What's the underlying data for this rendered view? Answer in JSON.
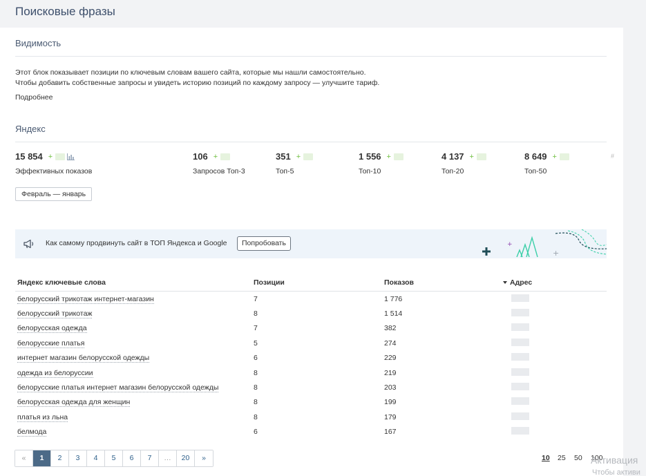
{
  "page": {
    "title": "Поисковые фразы"
  },
  "visibility": {
    "title": "Видимость",
    "desc_line1": "Этот блок показывает позиции по ключевым словам вашего сайта, которые мы нашли самостоятельно.",
    "desc_line2": "Чтобы добавить собственные запросы и увидеть историю позиций по каждому запросу — улучшите тариф.",
    "more_link": "Подробнее"
  },
  "yandex": {
    "title": "Яндекс",
    "stats": [
      {
        "value": "15 854",
        "plus": "+",
        "label": "Эффективных показов"
      },
      {
        "value": "106",
        "plus": "+",
        "label": "Запросов Топ-3"
      },
      {
        "value": "351",
        "plus": "+",
        "label": "Топ-5"
      },
      {
        "value": "1 556",
        "plus": "+",
        "label": "Топ-10"
      },
      {
        "value": "4 137",
        "plus": "+",
        "label": "Топ-20"
      },
      {
        "value": "8 649",
        "plus": "+",
        "label": "Топ-50"
      }
    ],
    "hash": "#",
    "period_button": "Февраль — январь"
  },
  "promo": {
    "text": "Как самому продвинуть сайт в ТОП Яндекса и Google",
    "button": "Попробовать",
    "colors": {
      "bg": "#eef4fa",
      "accent_green": "#3ccfa8",
      "accent_dark": "#1f4d57",
      "accent_purple": "#8e44ad"
    }
  },
  "table": {
    "headers": {
      "keyword": "Яндекс ключевые слова",
      "position": "Позиции",
      "views": "Показов",
      "address": "Адрес"
    },
    "rows": [
      {
        "keyword": "белорусский трикотаж интернет-магазин",
        "position": "7",
        "views": "1 776"
      },
      {
        "keyword": "белорусский трикотаж",
        "position": "8",
        "views": "1 514"
      },
      {
        "keyword": "белорусская одежда",
        "position": "7",
        "views": "382"
      },
      {
        "keyword": "белорусские платья",
        "position": "5",
        "views": "274"
      },
      {
        "keyword": "интернет магазин белорусской одежды",
        "position": "6",
        "views": "229"
      },
      {
        "keyword": "одежда из белоруссии",
        "position": "8",
        "views": "219"
      },
      {
        "keyword": "белорусские платья интернет магазин белорусской одежды",
        "position": "8",
        "views": "203"
      },
      {
        "keyword": "белорусская одежда для женщин",
        "position": "8",
        "views": "199"
      },
      {
        "keyword": "платья из льна",
        "position": "8",
        "views": "179"
      },
      {
        "keyword": "белмода",
        "position": "6",
        "views": "167"
      }
    ]
  },
  "pagination": {
    "prev": "«",
    "pages": [
      "1",
      "2",
      "3",
      "4",
      "5",
      "6",
      "7"
    ],
    "ellipsis": "…",
    "last": "20",
    "next": "»",
    "active": "1",
    "page_sizes": [
      "10",
      "25",
      "50",
      "100"
    ],
    "selected_size": "10"
  },
  "watermark": {
    "line1": "Активация",
    "line2": "Чтобы активи"
  }
}
